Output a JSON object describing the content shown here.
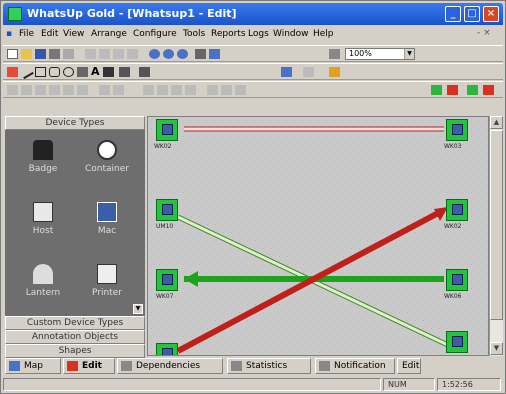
{
  "window": {
    "title": "WhatsUp Gold - [Whatsup1 - Edit]"
  },
  "menu": [
    "File",
    "Edit",
    "View",
    "Arrange",
    "Configure",
    "Tools",
    "Reports",
    "Logs",
    "Window",
    "Help"
  ],
  "mdi_controls": "- ×",
  "toolbar": {
    "zoom_value": "100%"
  },
  "sidebar": {
    "header": "Device Types",
    "devices": [
      "Badge",
      "Container",
      "Host",
      "Mac",
      "Lantern",
      "Printer"
    ],
    "sections": [
      "Custom Device Types",
      "Annotation Objects",
      "Shapes"
    ]
  },
  "canvas": {
    "nodes": [
      {
        "label": "WK02",
        "color": "#23c53d"
      },
      {
        "label": "WK03",
        "color": "#23c53d"
      },
      {
        "label": "UM10",
        "color": "#23c53d"
      },
      {
        "label": "WK02",
        "color": "#23c53d"
      },
      {
        "label": "WK07",
        "color": "#23c53d"
      },
      {
        "label": "WK06",
        "color": "#23c53d"
      },
      {
        "label": "",
        "color": "#23c53d"
      },
      {
        "label": "",
        "color": "#23c53d"
      }
    ],
    "link_colors": {
      "down": "#c0201a",
      "up": "#1ea31e",
      "light": "#d8f5c0",
      "pink": "#f3c4c4"
    }
  },
  "tabs": [
    "Map",
    "Edit",
    "Dependencies",
    "Statistics",
    "Notification",
    "Edit"
  ],
  "status": {
    "num": "NUM",
    "time": "1:52:56"
  },
  "colors": {
    "accent": "#1a53c8",
    "node_up": "#23c53d"
  }
}
